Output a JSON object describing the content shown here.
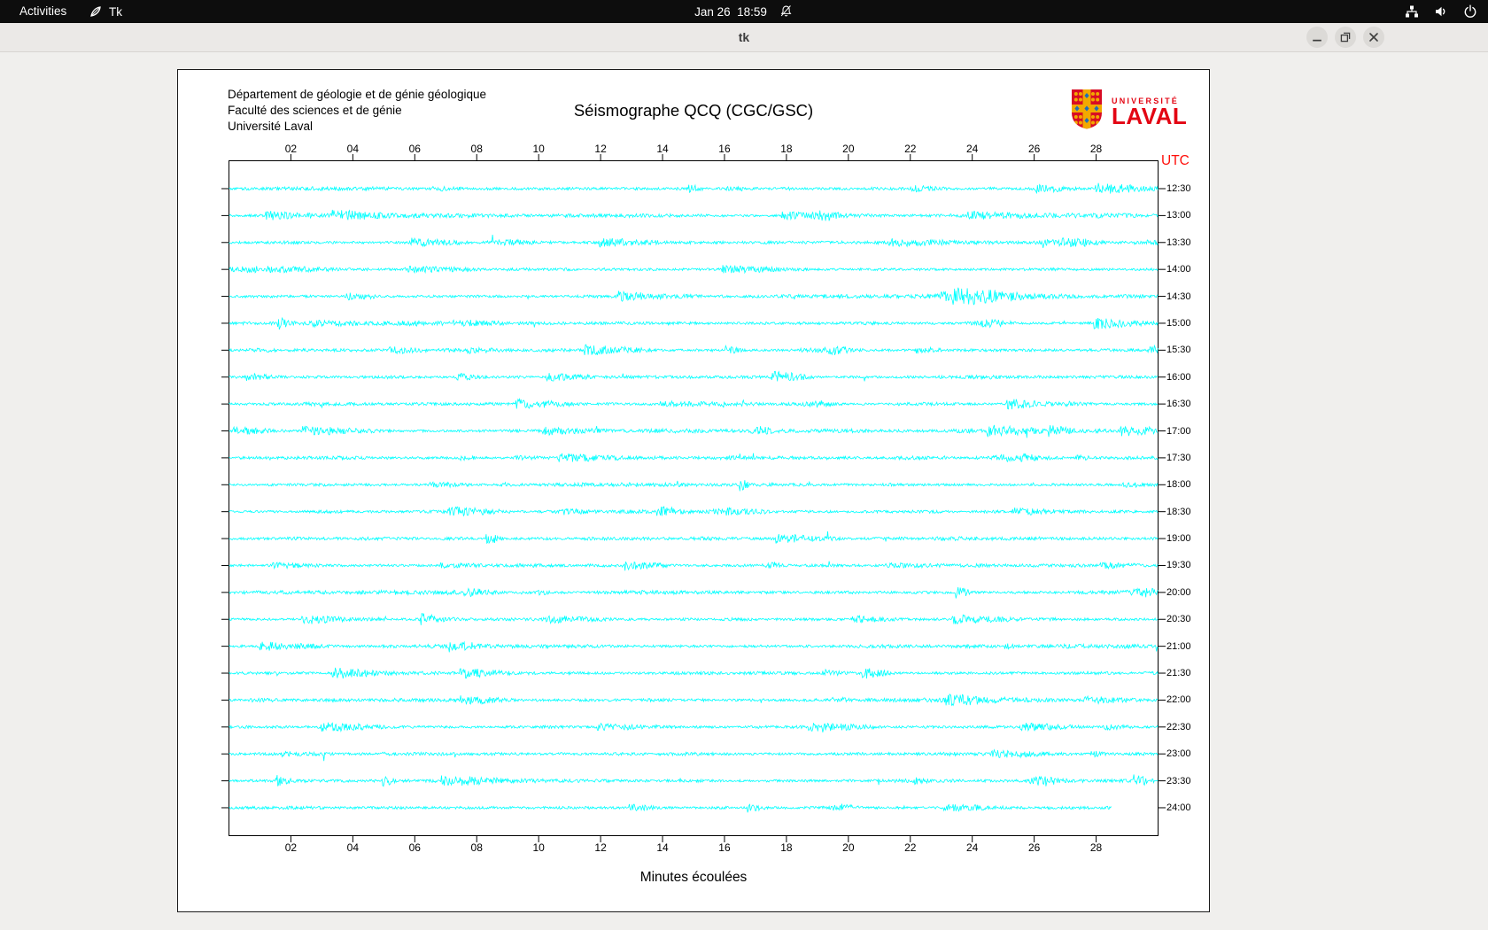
{
  "topbar": {
    "activities_label": "Activities",
    "app_name": "Tk",
    "app_icon": "tk-feather-icon",
    "clock": "Jan 26  18:59",
    "clock_icon": "notifications-disabled-icon",
    "status_icons": [
      "network-icon",
      "volume-icon",
      "power-icon"
    ]
  },
  "window": {
    "title": "tk",
    "controls": [
      "minimize",
      "maximize",
      "close"
    ]
  },
  "document": {
    "institution_lines": [
      "Département de géologie et de génie géologique",
      "Faculté des sciences et de génie",
      "Université Laval"
    ],
    "title": "Séismographe QCQ (CGC/GSC)",
    "logo": {
      "word_top": "UNIVERSITÉ",
      "word_bottom": "LAVAL"
    }
  },
  "chart_data": {
    "type": "line",
    "subtype": "helicorder-seismogram",
    "title": "Séismographe QCQ (CGC/GSC)",
    "xlabel": "Minutes écoulées",
    "right_axis_label": "UTC",
    "x_range_minutes": [
      0,
      30
    ],
    "x_ticks": [
      "02",
      "04",
      "06",
      "08",
      "10",
      "12",
      "14",
      "16",
      "18",
      "20",
      "22",
      "24",
      "26",
      "28"
    ],
    "trace_labels": [
      "12:30",
      "13:00",
      "13:30",
      "14:00",
      "14:30",
      "15:00",
      "15:30",
      "16:00",
      "16:30",
      "17:00",
      "17:30",
      "18:00",
      "18:30",
      "19:00",
      "19:30",
      "20:00",
      "20:30",
      "21:00",
      "21:30",
      "22:00",
      "22:30",
      "23:00",
      "23:30",
      "24:00"
    ],
    "last_trace_end_minute": 28.5,
    "trace_color": "#00ffff",
    "utc_label_color": "#ff0f0a",
    "axis_color": "#000000",
    "noise_seed": 20260126,
    "events": [
      {
        "trace": "13:00",
        "minute": 19.3,
        "amplitude": 3.5,
        "width": 0.25
      },
      {
        "trace": "13:30",
        "minute": 9.2,
        "amplitude": 2.5,
        "width": 0.5
      },
      {
        "trace": "13:30",
        "minute": 27.2,
        "amplitude": 4.5,
        "width": 0.55
      },
      {
        "trace": "14:00",
        "minute": 1.2,
        "amplitude": 2.5,
        "width": 1.2
      },
      {
        "trace": "14:30",
        "minute": 23.7,
        "amplitude": 9.5,
        "width": 0.45
      },
      {
        "trace": "14:30",
        "minute": 24.7,
        "amplitude": 5.5,
        "width": 0.3
      },
      {
        "trace": "15:00",
        "minute": 24.6,
        "amplitude": 3.5,
        "width": 0.4
      },
      {
        "trace": "15:30",
        "minute": 19.6,
        "amplitude": 4.0,
        "width": 0.25
      },
      {
        "trace": "16:30",
        "minute": 19.0,
        "amplitude": 3.0,
        "width": 0.3
      },
      {
        "trace": "17:00",
        "minute": 17.2,
        "amplitude": 3.5,
        "width": 0.2
      },
      {
        "trace": "17:30",
        "minute": 25.3,
        "amplitude": 3.5,
        "width": 0.5
      },
      {
        "trace": "19:30",
        "minute": 17.5,
        "amplitude": 3.0,
        "width": 0.2
      },
      {
        "trace": "20:00",
        "minute": 29.6,
        "amplitude": 4.0,
        "width": 0.3
      },
      {
        "trace": "23:30",
        "minute": 26.3,
        "amplitude": 5.0,
        "width": 0.35
      },
      {
        "trace": "24:00",
        "minute": 19.8,
        "amplitude": 3.0,
        "width": 0.3
      }
    ]
  }
}
